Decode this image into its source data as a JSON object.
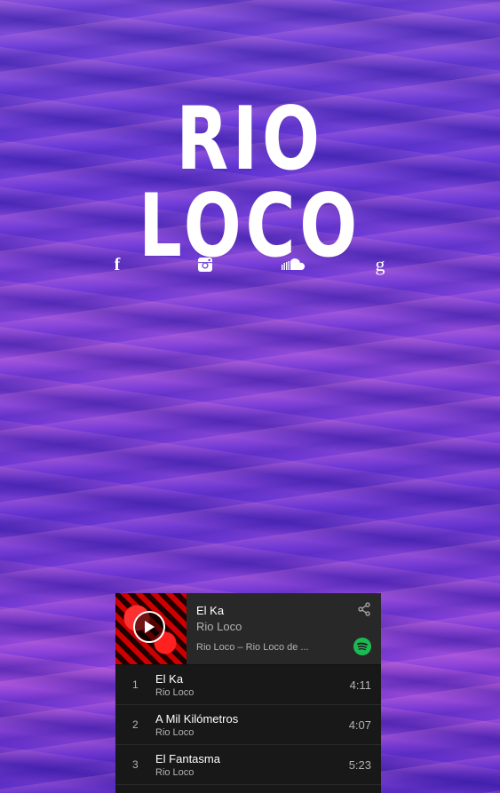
{
  "site": {
    "title": "RIO LOCO"
  },
  "social": [
    {
      "name": "facebook-icon",
      "glyph": "f"
    },
    {
      "name": "instagram-icon"
    },
    {
      "name": "soundcloud-icon"
    },
    {
      "name": "google-icon",
      "glyph": "g"
    }
  ],
  "player": {
    "now_playing": {
      "title": "El Ka",
      "artist": "Rio Loco",
      "album": "Rio Loco – Rio Loco de ..."
    },
    "tracks": [
      {
        "number": "1",
        "title": "El Ka",
        "artist": "Rio Loco",
        "duration": "4:11"
      },
      {
        "number": "2",
        "title": "A Mil Kilómetros",
        "artist": "Rio Loco",
        "duration": "4:07"
      },
      {
        "number": "3",
        "title": "El Fantasma",
        "artist": "Rio Loco",
        "duration": "5:23"
      }
    ]
  },
  "colors": {
    "spotify_green": "#1db954",
    "player_bg": "#181818",
    "player_head_bg": "#282828"
  }
}
